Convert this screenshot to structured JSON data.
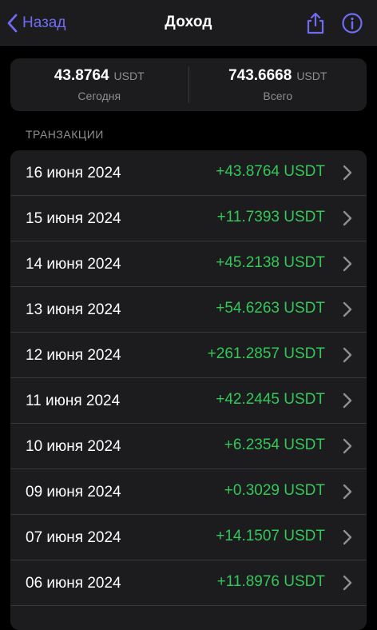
{
  "nav": {
    "back_label": "Назад",
    "title": "Доход",
    "share_icon": "share-icon",
    "info_icon": "info-icon"
  },
  "summary": {
    "today": {
      "value": "43.8764",
      "unit": "USDT",
      "label": "Сегодня"
    },
    "total": {
      "value": "743.6668",
      "unit": "USDT",
      "label": "Всего"
    }
  },
  "section_title": "ТРАНЗАКЦИИ",
  "transactions": [
    {
      "date": "16 июня 2024",
      "amount": "+43.8764 USDT"
    },
    {
      "date": "15 июня 2024",
      "amount": "+11.7393 USDT"
    },
    {
      "date": "14 июня 2024",
      "amount": "+45.2138 USDT"
    },
    {
      "date": "13 июня 2024",
      "amount": "+54.6263 USDT"
    },
    {
      "date": "12 июня 2024",
      "amount": "+261.2857 USDT"
    },
    {
      "date": "11 июня 2024",
      "amount": "+42.2445 USDT"
    },
    {
      "date": "10 июня 2024",
      "amount": "+6.2354 USDT"
    },
    {
      "date": "09 июня 2024",
      "amount": "+0.3029 USDT"
    },
    {
      "date": "07 июня 2024",
      "amount": "+14.1507 USDT"
    },
    {
      "date": "06 июня 2024",
      "amount": "+11.8976 USDT"
    }
  ],
  "colors": {
    "accent": "#6f6cf2",
    "positive": "#34c759",
    "background": "#000000",
    "card": "#1c1c1e",
    "secondary_text": "#8e8e93"
  }
}
